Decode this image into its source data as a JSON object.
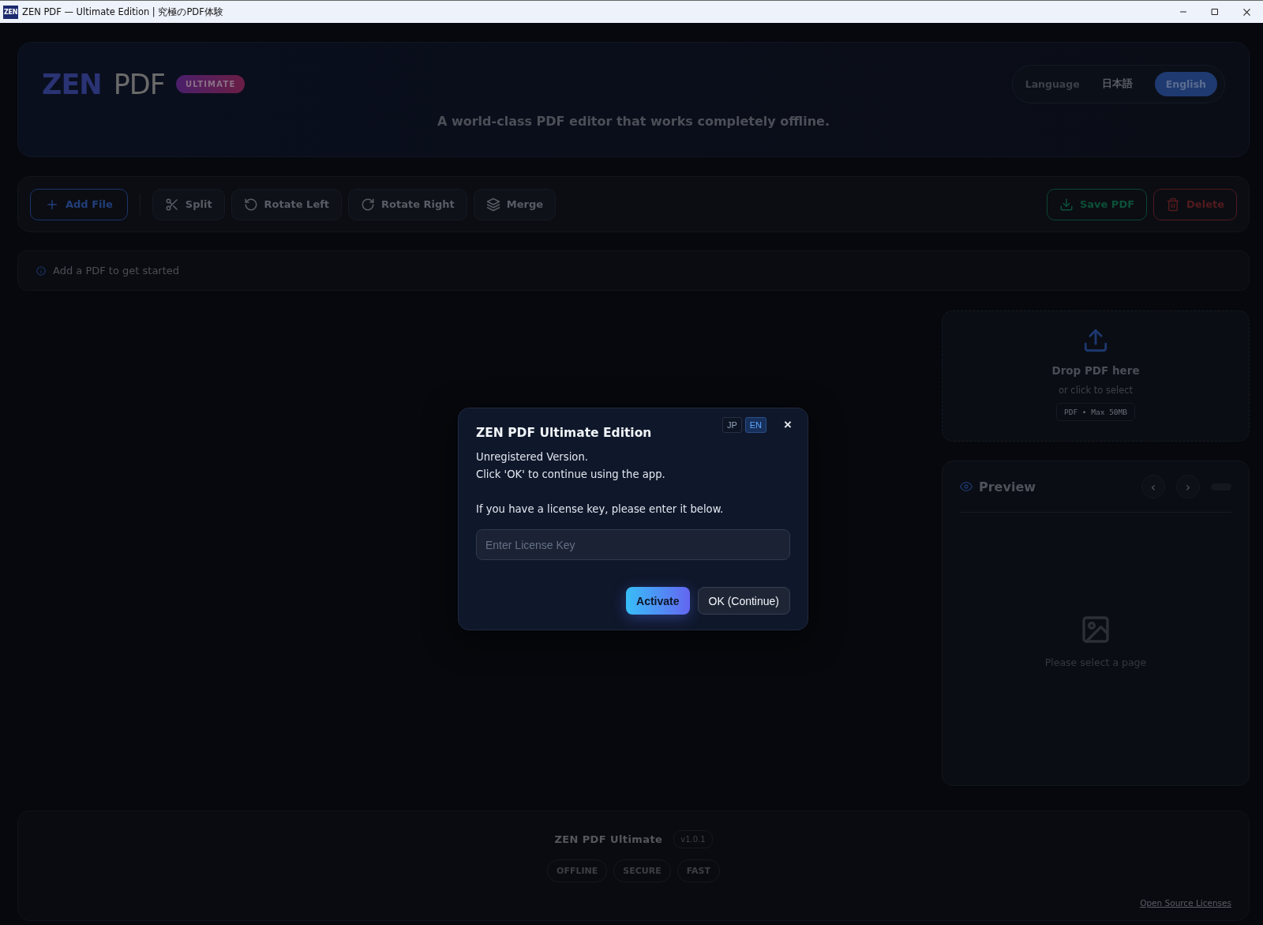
{
  "window": {
    "app_icon_text": "ZEN",
    "title": "ZEN PDF — Ultimate Edition | 究極のPDF体験"
  },
  "header": {
    "logo_first": "ZEN",
    "logo_second": "PDF",
    "badge": "ULTIMATE",
    "tagline": "A world-class PDF editor that works completely offline.",
    "language": {
      "label": "Language",
      "options": [
        {
          "label": "日本語",
          "selected": false
        },
        {
          "label": "English",
          "selected": true
        }
      ]
    }
  },
  "toolbar": {
    "buttons": [
      {
        "label": "Add File",
        "kind": "add"
      },
      {
        "label": "Split",
        "kind": "split"
      },
      {
        "label": "Rotate Left",
        "kind": "rotate-left"
      },
      {
        "label": "Rotate Right",
        "kind": "rotate-right"
      },
      {
        "label": "Merge",
        "kind": "merge"
      },
      {
        "label": "Save PDF",
        "kind": "save"
      },
      {
        "label": "Delete",
        "kind": "delete"
      }
    ]
  },
  "status": {
    "message": "Add a PDF to get started"
  },
  "dropzone": {
    "title": "Drop PDF here",
    "subtitle": "or click to select",
    "hint": "PDF • Max 50MB"
  },
  "preview": {
    "title": "Preview",
    "prev": "‹",
    "next": "›",
    "empty_message": "Please select a page"
  },
  "footer": {
    "name": "ZEN PDF Ultimate",
    "version": "v1.0.1",
    "tags": [
      "OFFLINE",
      "SECURE",
      "FAST"
    ],
    "link": "Open Source Licenses"
  },
  "dialog": {
    "title": "ZEN PDF Ultimate Edition",
    "languages": [
      {
        "label": "JP",
        "selected": false
      },
      {
        "label": "EN",
        "selected": true
      }
    ],
    "close": "×",
    "lines": [
      "Unregistered Version.",
      "Click 'OK' to continue using the app."
    ],
    "note": "If you have a license key, please enter it below.",
    "license_field": {
      "placeholder": "Enter License Key"
    },
    "buttons": [
      {
        "label": "Activate",
        "kind": "primary"
      },
      {
        "label": "OK (Continue)",
        "kind": "secondary"
      }
    ]
  }
}
